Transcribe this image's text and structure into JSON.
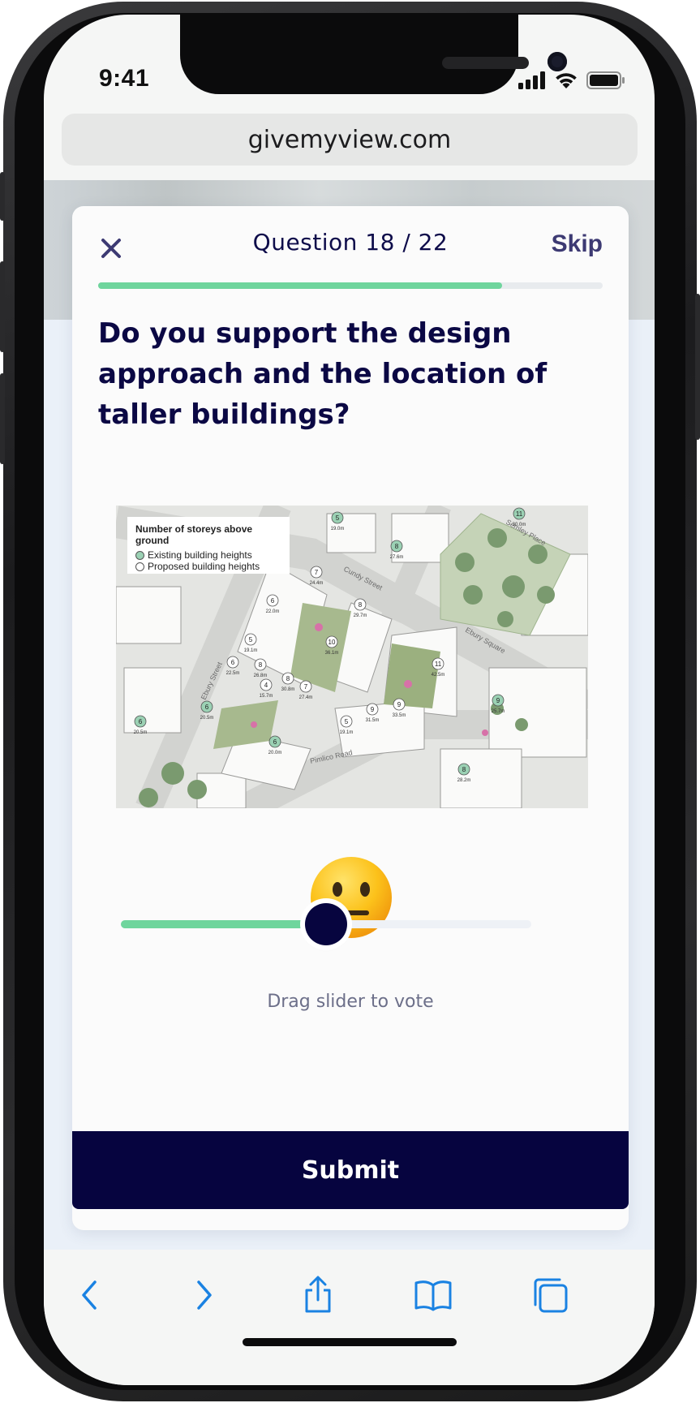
{
  "status_bar": {
    "time": "9:41"
  },
  "browser": {
    "url": "givemyview.com"
  },
  "survey": {
    "counter": "Question 18 / 22",
    "skip_label": "Skip",
    "progress_fraction": 0.8,
    "question": "Do you support the design approach and the location of taller buildings?",
    "image": {
      "legend_title": "Number of storeys above ground",
      "legend_existing": "Existing building heights",
      "legend_proposed": "Proposed building heights",
      "street_labels": [
        "Cundy Street",
        "Semley Place",
        "Ebury Square",
        "Ebury Street",
        "Pimlico Road"
      ],
      "markers": [
        {
          "n": "5",
          "h": "19.0m",
          "existing": true
        },
        {
          "n": "11",
          "h": "30.0m",
          "existing": true
        },
        {
          "n": "8",
          "h": "27.6m",
          "existing": true
        },
        {
          "n": "7",
          "h": "24.4m",
          "existing": false
        },
        {
          "n": "6",
          "h": "22.0m",
          "existing": false
        },
        {
          "n": "8",
          "h": "29.7m",
          "existing": false
        },
        {
          "n": "5",
          "h": "19.1m",
          "existing": false
        },
        {
          "n": "10",
          "h": "36.1m",
          "existing": false
        },
        {
          "n": "6",
          "h": "22.5m",
          "existing": false
        },
        {
          "n": "8",
          "h": "26.8m",
          "existing": false
        },
        {
          "n": "11",
          "h": "42.5m",
          "existing": false
        },
        {
          "n": "4",
          "h": "15.7m",
          "existing": false
        },
        {
          "n": "8",
          "h": "30.8m",
          "existing": false
        },
        {
          "n": "7",
          "h": "27.4m",
          "existing": false
        },
        {
          "n": "6",
          "h": "20.5m",
          "existing": true
        },
        {
          "n": "9",
          "h": "25.7m",
          "existing": true
        },
        {
          "n": "9",
          "h": "31.5m",
          "existing": false
        },
        {
          "n": "9",
          "h": "33.5m",
          "existing": false
        },
        {
          "n": "5",
          "h": "19.1m",
          "existing": false
        },
        {
          "n": "6",
          "h": "20.5m",
          "existing": true
        },
        {
          "n": "6",
          "h": "20.0m",
          "existing": true
        },
        {
          "n": "8",
          "h": "28.2m",
          "existing": true
        }
      ]
    },
    "slider": {
      "value": 0.5,
      "mood": "neutral-face"
    },
    "slider_hint": "Drag slider to vote",
    "submit_label": "Submit"
  },
  "toolbar": {
    "items": [
      "back-icon",
      "forward-icon",
      "share-icon",
      "bookmarks-icon",
      "tabs-icon"
    ],
    "accent": "#1a82e2"
  },
  "colors": {
    "navy": "#06043f",
    "green": "#6fd59d",
    "skip": "#3d3a73"
  }
}
